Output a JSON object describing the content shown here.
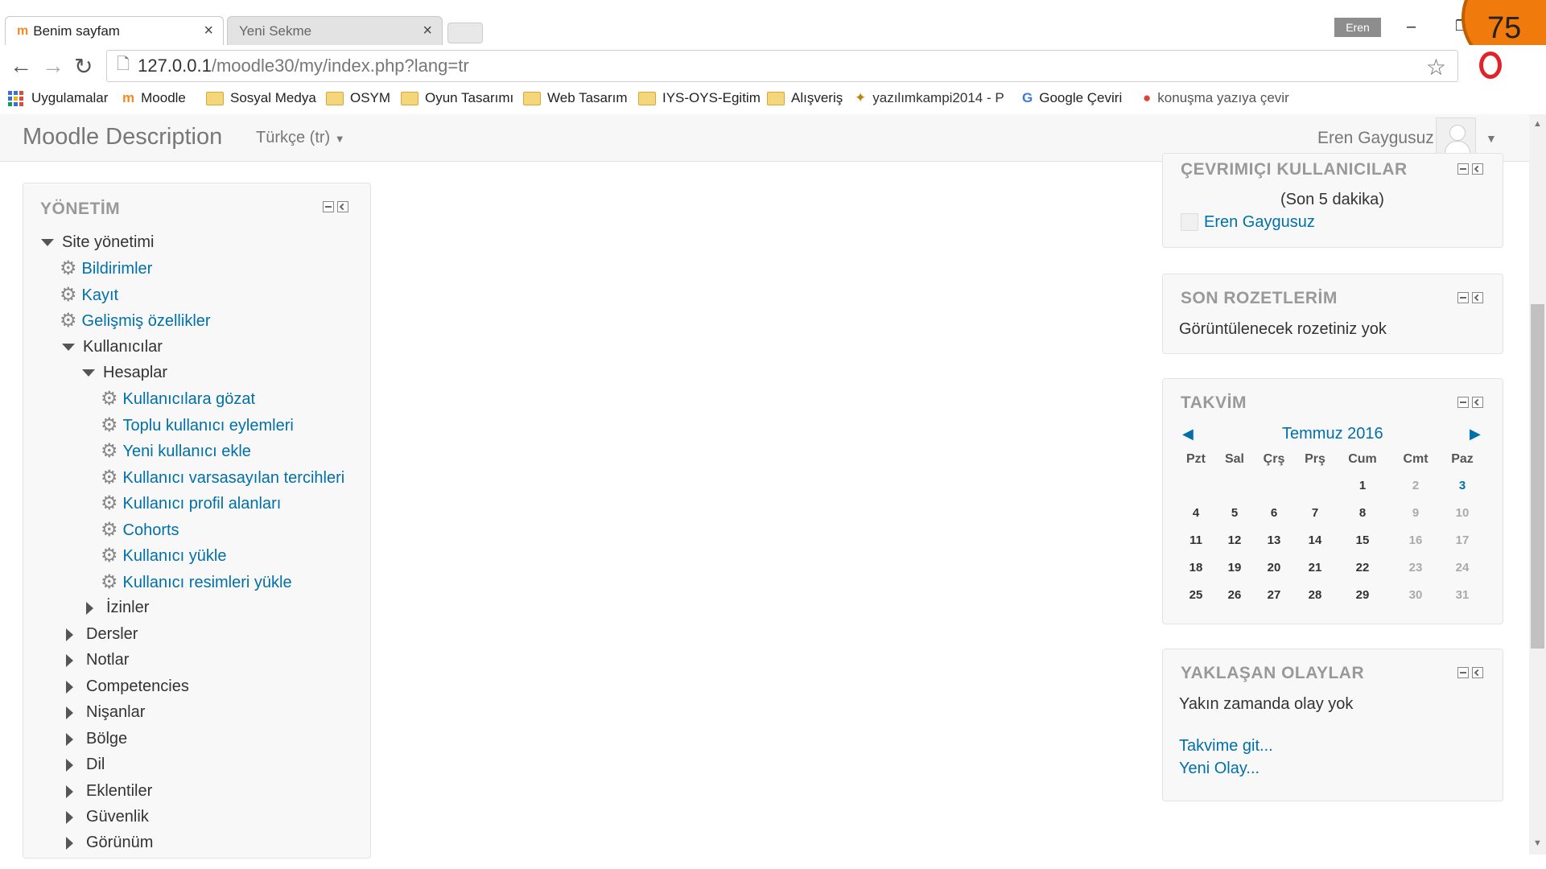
{
  "browser": {
    "tabs": [
      {
        "title": "Benim sayfam",
        "active": true
      },
      {
        "title": "Yeni Sekme",
        "active": false
      }
    ],
    "profile_badge": "Eren",
    "counter": "75",
    "url_host": "127.0.0.1",
    "url_path": "/moodle30/my/index.php?lang=tr",
    "bookmarks": [
      {
        "label": "Uygulamalar",
        "icon": "apps-grid-icon"
      },
      {
        "label": "Moodle",
        "icon": "moodle-icon"
      },
      {
        "label": "Sosyal Medya",
        "icon": "folder-icon"
      },
      {
        "label": "OSYM",
        "icon": "folder-icon"
      },
      {
        "label": "Oyun Tasarımı",
        "icon": "folder-icon"
      },
      {
        "label": "Web Tasarım",
        "icon": "folder-icon"
      },
      {
        "label": "IYS-OYS-Egitim",
        "icon": "folder-icon"
      },
      {
        "label": "Alışveriş",
        "icon": "folder-icon"
      },
      {
        "label": "yazılımkampi2014 - P",
        "icon": "site-icon"
      },
      {
        "label": "Google Çeviri",
        "icon": "translate-icon"
      },
      {
        "label": "konuşma yazıya çevir",
        "icon": "chrome-icon"
      }
    ]
  },
  "header": {
    "brand": "Moodle Description",
    "language": "Türkçe (tr)",
    "user_name": "Eren Gaygusuz"
  },
  "admin_block": {
    "title": "YÖNETİM",
    "items": [
      {
        "label": "Site yönetimi",
        "type": "open"
      },
      {
        "label": "Bildirimler",
        "type": "link"
      },
      {
        "label": "Kayıt",
        "type": "link"
      },
      {
        "label": "Gelişmiş özellikler",
        "type": "link"
      },
      {
        "label": "Kullanıcılar",
        "type": "open"
      },
      {
        "label": "Hesaplar",
        "type": "open"
      },
      {
        "label": "Kullanıcılara gözat",
        "type": "link"
      },
      {
        "label": "Toplu kullanıcı eylemleri",
        "type": "link"
      },
      {
        "label": "Yeni kullanıcı ekle",
        "type": "link"
      },
      {
        "label": "Kullanıcı varsasayılan tercihleri",
        "type": "link"
      },
      {
        "label": "Kullanıcı profil alanları",
        "type": "link"
      },
      {
        "label": "Cohorts",
        "type": "link"
      },
      {
        "label": "Kullanıcı yükle",
        "type": "link"
      },
      {
        "label": "Kullanıcı resimleri yükle",
        "type": "link"
      },
      {
        "label": "İzinler",
        "type": "closed"
      },
      {
        "label": "Dersler",
        "type": "closed"
      },
      {
        "label": "Notlar",
        "type": "closed"
      },
      {
        "label": "Competencies",
        "type": "closed"
      },
      {
        "label": "Nişanlar",
        "type": "closed"
      },
      {
        "label": "Bölge",
        "type": "closed"
      },
      {
        "label": "Dil",
        "type": "closed"
      },
      {
        "label": "Eklentiler",
        "type": "closed"
      },
      {
        "label": "Güvenlik",
        "type": "closed"
      },
      {
        "label": "Görünüm",
        "type": "closed"
      }
    ]
  },
  "online_users": {
    "title": "ÇEVRIMIÇI KULLANICILAR",
    "subtitle": "(Son 5 dakika)",
    "users": [
      "Eren Gaygusuz"
    ]
  },
  "badges": {
    "title": "SON ROZETLERİM",
    "empty": "Görüntülenecek rozetiniz yok"
  },
  "calendar": {
    "title": "TAKVİM",
    "month": "Temmuz 2016",
    "weekdays": [
      "Pzt",
      "Sal",
      "Çrş",
      "Prş",
      "Cum",
      "Cmt",
      "Paz"
    ],
    "weeks": [
      [
        "",
        "",
        "",
        "",
        "1",
        "2",
        "3"
      ],
      [
        "4",
        "5",
        "6",
        "7",
        "8",
        "9",
        "10"
      ],
      [
        "11",
        "12",
        "13",
        "14",
        "15",
        "16",
        "17"
      ],
      [
        "18",
        "19",
        "20",
        "21",
        "22",
        "23",
        "24"
      ],
      [
        "25",
        "26",
        "27",
        "28",
        "29",
        "30",
        "31"
      ]
    ],
    "today": "3"
  },
  "upcoming": {
    "title": "YAKLAŞAN OLAYLAR",
    "empty": "Yakın zamanda olay yok",
    "go_calendar": "Takvime git...",
    "new_event": "Yeni Olay..."
  }
}
